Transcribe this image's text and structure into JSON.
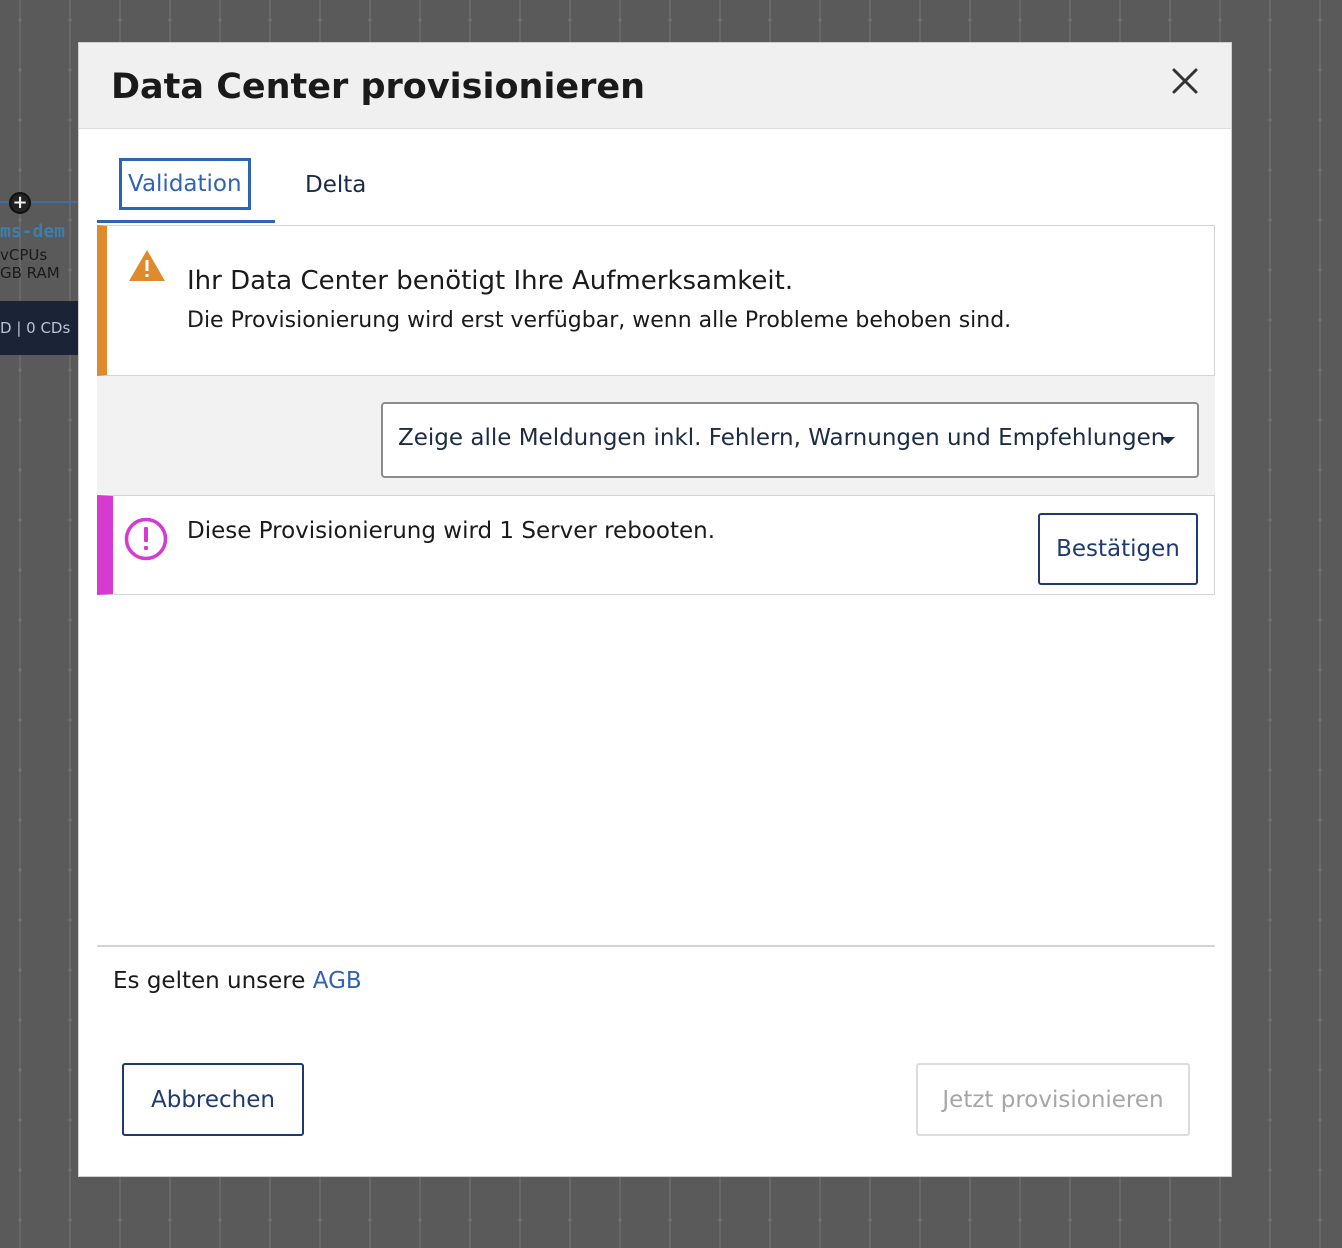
{
  "background": {
    "node_name": "ms-dem",
    "node_cpus": "vCPUs",
    "node_ram": "GB RAM",
    "node_storage": "D | 0 CDs"
  },
  "dialog": {
    "title": "Data Center provisionieren",
    "close_icon": "close-icon",
    "tabs": [
      {
        "label": "Validation",
        "active": true
      },
      {
        "label": "Delta",
        "active": false
      }
    ],
    "warning": {
      "icon": "warning-triangle-icon",
      "color": "#e08a2e",
      "title": "Ihr Data Center benötigt Ihre Aufmerksamkeit.",
      "subtitle": "Die Provisionierung wird erst verfügbar, wenn alle Probleme behoben sind."
    },
    "filter": {
      "selected": "Zeige alle Meldungen inkl. Fehlern, Warnungen und Empfehlungen"
    },
    "notice": {
      "icon": "exclamation-circle-icon",
      "color": "#d63ad3",
      "text": "Diese Provisionierung wird 1 Server rebooten.",
      "confirm_label": "Bestätigen"
    },
    "terms": {
      "prefix": "Es gelten unsere",
      "link_label": "AGB"
    },
    "footer": {
      "cancel_label": "Abbrechen",
      "provision_label": "Jetzt provisionieren"
    }
  }
}
